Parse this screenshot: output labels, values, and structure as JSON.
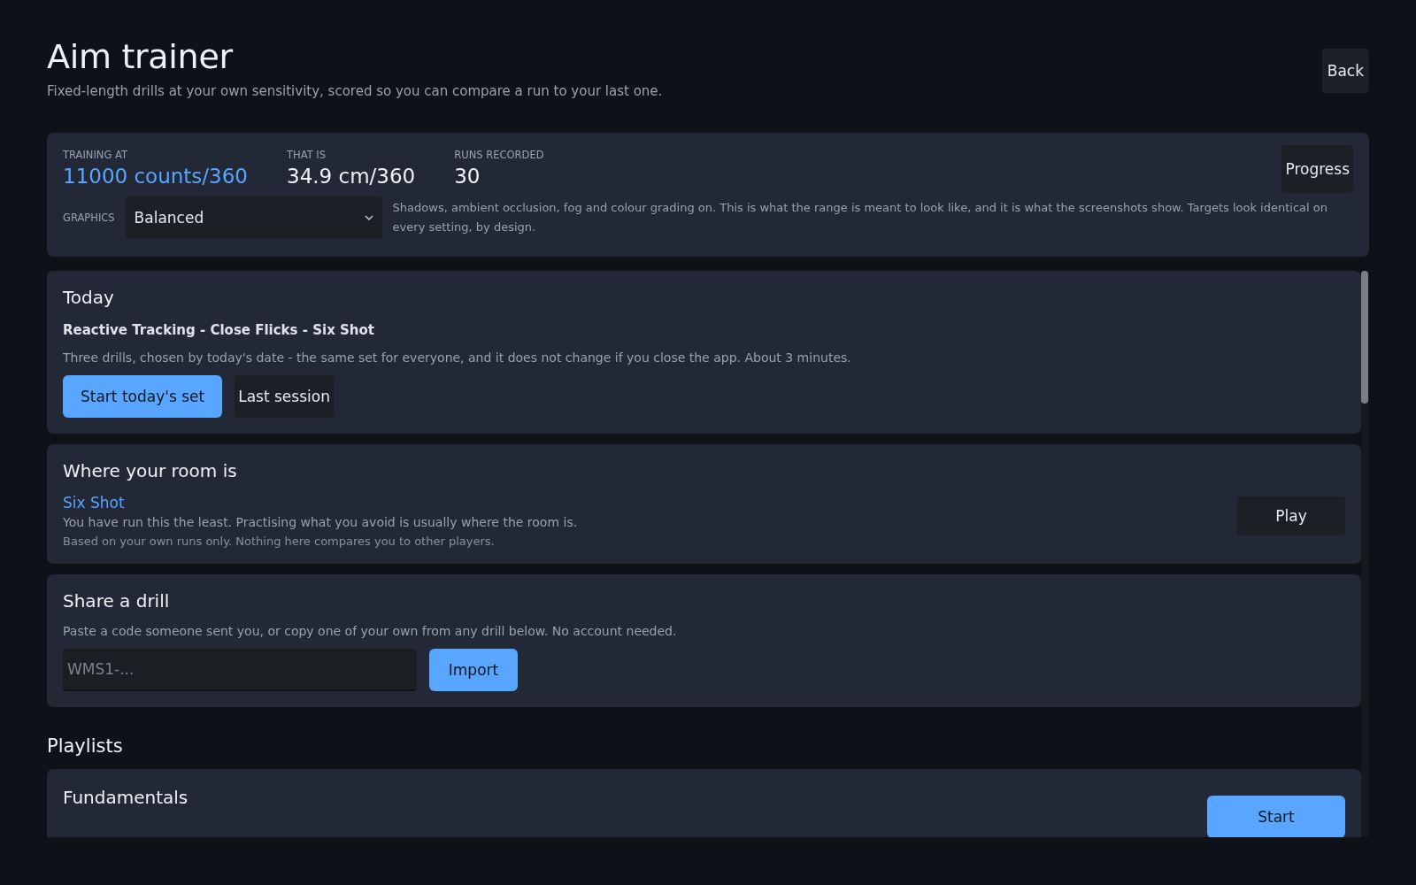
{
  "header": {
    "title": "Aim trainer",
    "subtitle": "Fixed-length drills at your own sensitivity, scored so you can compare a run to your last one.",
    "back_button": "Back"
  },
  "settings": {
    "stats": [
      {
        "label": "TRAINING AT",
        "value": "11000 counts/360",
        "highlighted": true
      },
      {
        "label": "THAT IS",
        "value": "34.9 cm/360",
        "highlighted": false
      },
      {
        "label": "RUNS RECORDED",
        "value": "30",
        "highlighted": false
      }
    ],
    "progress_button": "Progress",
    "graphics": {
      "label": "GRAPHICS",
      "value": "Balanced",
      "description": "Shadows, ambient occlusion, fog and colour grading on. This is what the range is meant to look like, and it is what the screenshots show.  Targets look identical on every setting, by design."
    }
  },
  "today": {
    "heading": "Today",
    "drills": "Reactive Tracking - Close Flicks - Six Shot",
    "note": "Three drills, chosen by today's date - the same set for everyone, and it does not change if you close the app. About 3 minutes.",
    "buttons": [
      {
        "label": "Start today's set",
        "kind": "primary"
      },
      {
        "label": "Last session",
        "kind": "secondary"
      }
    ]
  },
  "room": {
    "heading": "Where your room is",
    "drill": "Six Shot",
    "reason": "You have run this the least. Practising what you avoid is usually where the room is.",
    "footnote": "Based on your own runs only. Nothing here compares you to other players.",
    "play_button": "Play"
  },
  "share": {
    "heading": "Share a drill",
    "note": "Paste a code someone sent you, or copy one of your own from any drill below. No account needed.",
    "code_field": {
      "placeholder": "WMS1-..."
    },
    "import_button": "Import"
  },
  "playlists": {
    "heading": "Playlists",
    "items": [
      {
        "name": "Fundamentals",
        "button": "Start"
      }
    ]
  }
}
